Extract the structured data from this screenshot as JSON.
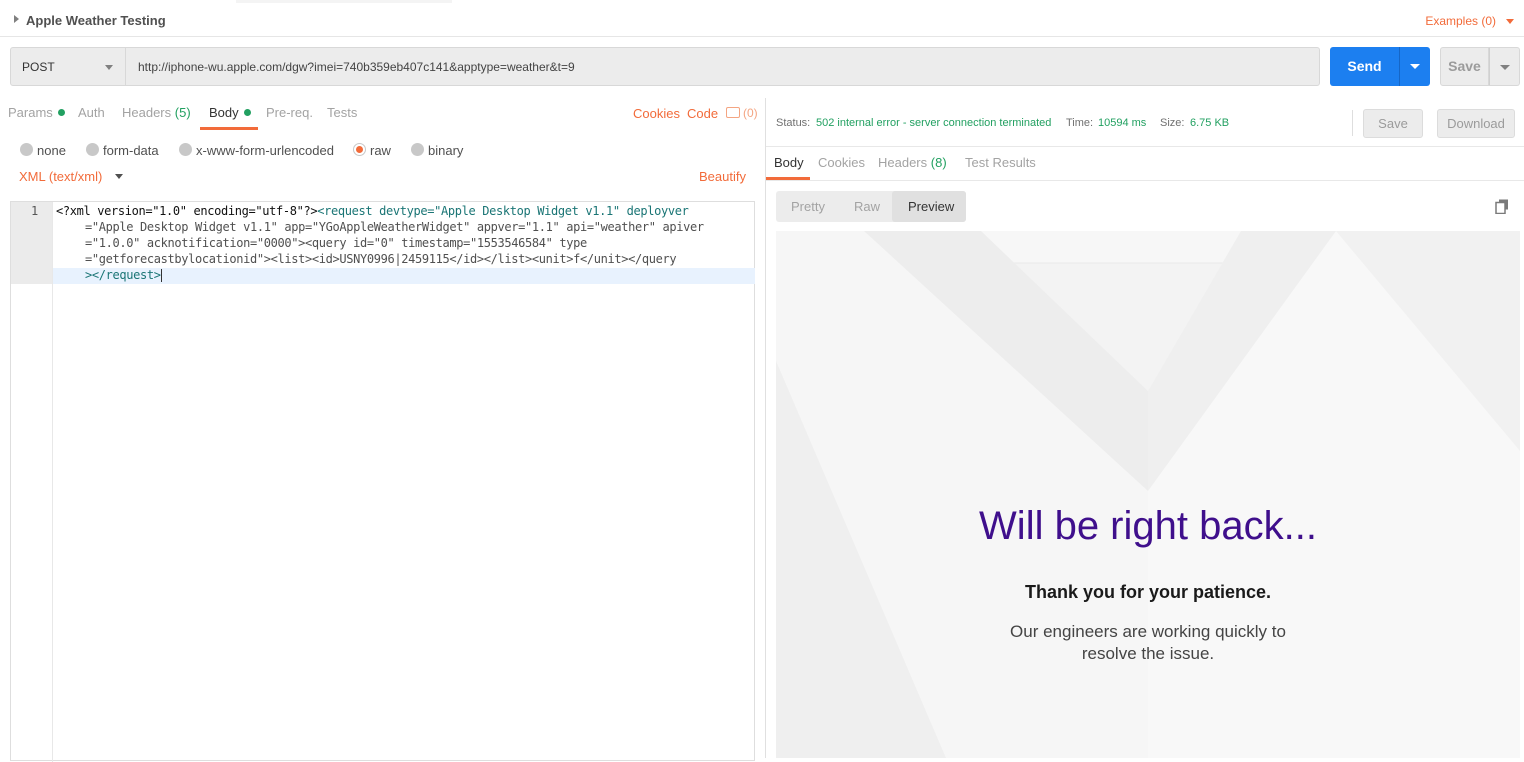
{
  "header": {
    "collection_title": "Apple Weather Testing",
    "examples_label": "Examples (0)"
  },
  "request": {
    "method": "POST",
    "url": "http://iphone-wu.apple.com/dgw?imei=740b359eb407c141&apptype=weather&t=9",
    "send_label": "Send",
    "save_label": "Save"
  },
  "request_tabs": {
    "params": "Params",
    "auth": "Auth",
    "headers": "Headers",
    "headers_count": "(5)",
    "body": "Body",
    "prereq": "Pre-req.",
    "tests": "Tests",
    "cookies": "Cookies",
    "code": "Code",
    "comments_count": "(0)"
  },
  "body_modes": {
    "none": "none",
    "form_data": "form-data",
    "urlencoded": "x-www-form-urlencoded",
    "raw": "raw",
    "binary": "binary",
    "selected": "raw",
    "content_type": "XML (text/xml)",
    "beautify": "Beautify"
  },
  "editor": {
    "line_number": "1",
    "line1_a": "<?xml version=\"1.0\" encoding=\"utf-8\"?>",
    "line1_b": "<request devtype=\"Apple Desktop Widget v1.1\" deployver",
    "line2": "=\"Apple Desktop Widget v1.1\" app=\"YGoAppleWeatherWidget\" appver=\"1.1\" api=\"weather\" apiver",
    "line3": "=\"1.0.0\" acknotification=\"0000\"><query id=\"0\" timestamp=\"1553546584\" type",
    "line4": "=\"getforecastbylocationid\"><list><id>USNY0996|2459115</id></list><unit>f</unit></query",
    "line5": "></request>"
  },
  "response": {
    "status_label": "Status:",
    "status_value": "502 internal error - server connection terminated",
    "time_label": "Time:",
    "time_value": "10594 ms",
    "size_label": "Size:",
    "size_value": "6.75 KB",
    "save_label": "Save",
    "download_label": "Download",
    "tabs": {
      "body": "Body",
      "cookies": "Cookies",
      "headers": "Headers",
      "headers_count": "(8)",
      "test_results": "Test Results"
    },
    "view_modes": {
      "pretty": "Pretty",
      "raw": "Raw",
      "preview": "Preview",
      "selected": "Preview"
    },
    "preview": {
      "title": "Will be right back...",
      "subtitle": "Thank you for your patience.",
      "message": "Our engineers are working quickly to resolve the issue."
    }
  },
  "colors": {
    "accent_orange": "#f26b3a",
    "send_blue": "#1c7ff0",
    "status_green": "#22a061",
    "preview_purple": "#3f0f8c"
  }
}
